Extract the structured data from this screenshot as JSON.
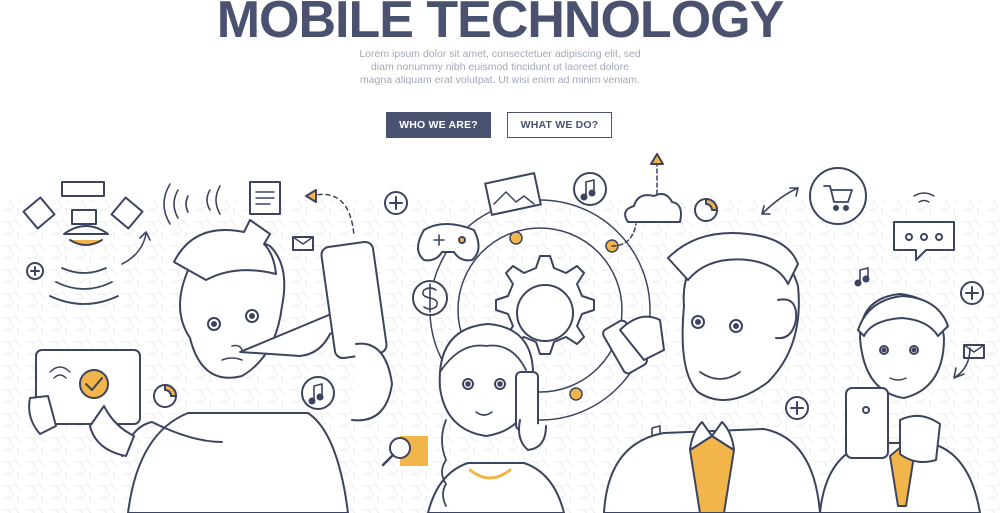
{
  "header": {
    "title": "MOBILE TECHNOLOGY",
    "subtitle_lines": [
      "Lorem ipsum dolor sit amet, consectetuer adipiscing elit, sed",
      "diam nonummy nibh euismod tincidunt ut laoreet dolore",
      "magna aliquam erat volutpat. Ut wisi enim ad minim veniam."
    ]
  },
  "buttons": {
    "primary_label": "WHO WE ARE?",
    "secondary_label": "WHAT WE DO?"
  },
  "colors": {
    "primary": "#4a5270",
    "accent": "#f2b54a",
    "outline": "#3d4460",
    "muted": "#a3a8b8"
  },
  "illustration": {
    "icons": [
      "satellite-icon",
      "wifi-icon",
      "tablet-check-icon",
      "document-icon",
      "mail-icon",
      "gamepad-icon",
      "image-icon",
      "music-note-icon",
      "cloud-icon",
      "donut-chart-icon",
      "gear-icon",
      "dollar-icon",
      "shopping-cart-icon",
      "chat-bubble-icon",
      "search-icon",
      "plus-icon",
      "smartphone-icon"
    ],
    "people": [
      "man-pointing-phone",
      "girl-with-phone",
      "man-on-phone-call",
      "man-in-suit-phone"
    ]
  }
}
